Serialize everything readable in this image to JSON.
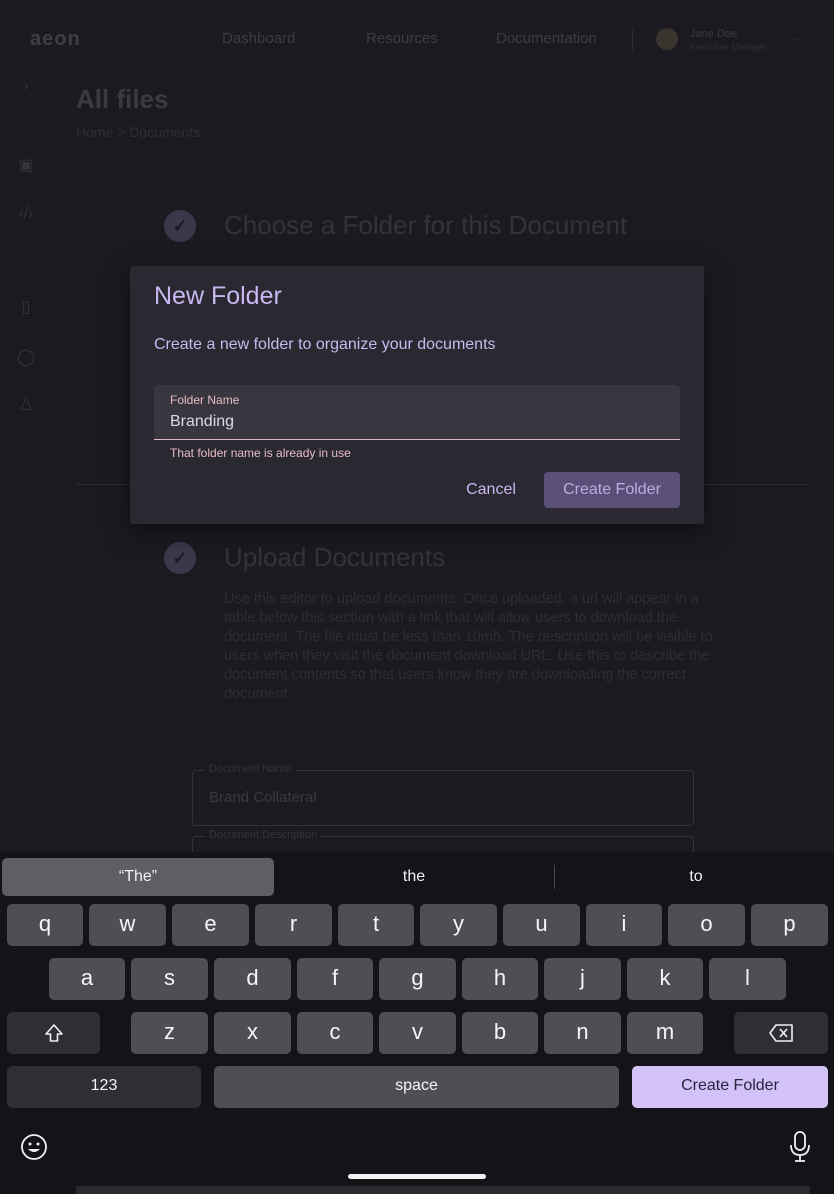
{
  "app": {
    "logo": "aeon",
    "nav": [
      "Dashboard",
      "Resources",
      "Documentation"
    ],
    "user": {
      "name": "Jane Doe",
      "role": "Executive Manager"
    }
  },
  "page": {
    "title": "All files",
    "breadcrumb": "Home > Documents",
    "steps": [
      {
        "title": "Choose a Folder for this Document"
      },
      {
        "title": "Upload Documents",
        "description": "Use this editor to upload documents. Once uploaded, a url will appear in a table below this section with a link that will allow users to download the document. The file must be less than 10mb. The description will be visible to users when they visit the document download URL. Use this to describe the document contents so that users know they are downloading the correct document."
      }
    ],
    "fields": [
      {
        "label": "Document Name",
        "value": "Brand Collateral"
      },
      {
        "label": "Document Description",
        "value": ""
      }
    ]
  },
  "dialog": {
    "title": "New Folder",
    "subtitle": "Create a new folder to organize your documents",
    "field_label": "Folder Name",
    "field_value": "Branding",
    "error": "That folder name is already in use",
    "cancel_label": "Cancel",
    "create_label": "Create Folder",
    "colors": {
      "accent": "#c9b7f0",
      "error": "#e9bcc4",
      "button": "#5b4f7a"
    }
  },
  "keyboard": {
    "suggestions": [
      "“The”",
      "the",
      "to"
    ],
    "row1": [
      "q",
      "w",
      "e",
      "r",
      "t",
      "y",
      "u",
      "i",
      "o",
      "p"
    ],
    "row2": [
      "a",
      "s",
      "d",
      "f",
      "g",
      "h",
      "j",
      "k",
      "l"
    ],
    "row3": [
      "z",
      "x",
      "c",
      "v",
      "b",
      "n",
      "m"
    ],
    "numbers_label": "123",
    "space_label": "space",
    "action_label": "Create Folder",
    "icons": [
      "shift-icon",
      "backspace-icon",
      "emoji-icon",
      "microphone-icon"
    ]
  }
}
